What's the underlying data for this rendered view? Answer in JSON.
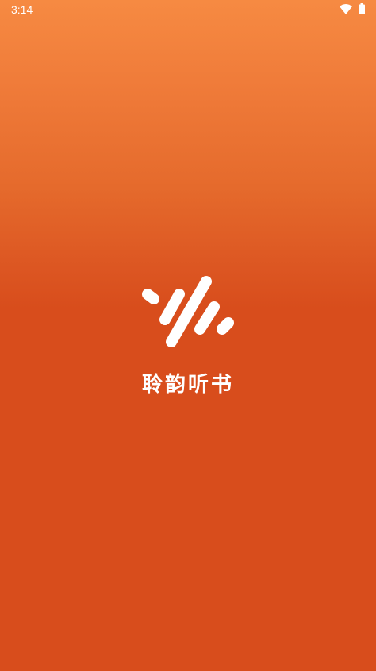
{
  "status_bar": {
    "time": "3:14",
    "icons": [
      "wifi-icon",
      "battery-icon"
    ]
  },
  "splash": {
    "logo_icon": "sound-wave-logo",
    "app_name": "聆韵听书"
  },
  "colors": {
    "background_top": "#f68a42",
    "background_bottom": "#d84d1c",
    "foreground": "#ffffff"
  }
}
